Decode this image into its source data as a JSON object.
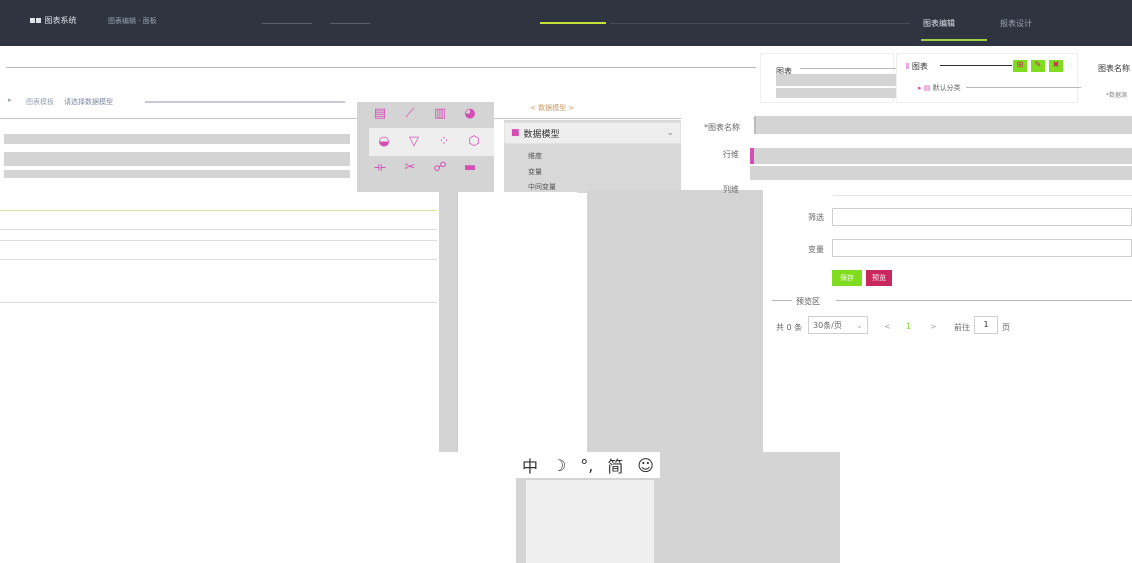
{
  "nav": {
    "brand": "图表系统",
    "crumb": "图表编辑 · 面板",
    "tabs": [
      "图表编辑",
      "报表设计"
    ]
  },
  "chart_panel": {
    "title": "图表",
    "right_title": "图表名称",
    "charts_label": "图表",
    "default_category": "默认分类",
    "data_source": "*数据源"
  },
  "left": {
    "filter_text": "请选择数据模型",
    "tab_label": "图表模板"
  },
  "data_model": {
    "title": "数据模型",
    "items": [
      "维度",
      "变量",
      "中间变量"
    ],
    "breadcrumb": "< 数据模型 >"
  },
  "form": {
    "chart_name_label": "*图表名称",
    "row_label": "行维",
    "col_label": "列维",
    "filter_label": "筛选",
    "variable_label": "变量"
  },
  "buttons": {
    "save": "保存",
    "preview": "预览"
  },
  "preview": {
    "label": "预览区",
    "total": "共 0 条",
    "page_size": "30条/页",
    "prev": "<",
    "current_page": "1",
    "next": ">",
    "goto": "前往",
    "goto_page": "1",
    "page_unit": "页"
  },
  "ime": {
    "chars": [
      "中",
      "☽",
      "°,",
      "简",
      "☺"
    ]
  },
  "colors": {
    "nav_bg": "#2f3440",
    "accent_green": "#7fdc1e",
    "accent_pink": "#c8285c",
    "accent_purple": "#d44eb6"
  },
  "icons": [
    "table-icon",
    "line-chart-icon",
    "bar-chart-icon",
    "pie-chart-icon",
    "area-chart-icon",
    "funnel-icon",
    "scatter-icon",
    "radar-icon",
    "gantt-icon",
    "map-icon",
    "link-icon",
    "gauge-icon"
  ]
}
